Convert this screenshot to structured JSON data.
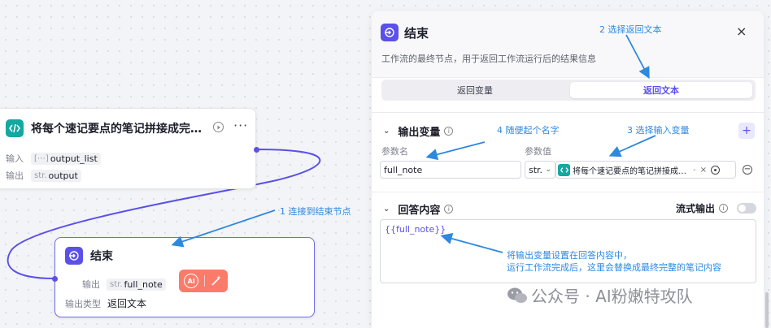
{
  "canvas": {
    "joiner_node": {
      "title": "将每个速记要点的笔记拼接成完…",
      "inputs_label": "输入",
      "inputs_prefix": "[⋯]",
      "inputs_value": "output_list",
      "outputs_label": "输出",
      "outputs_prefix": "str.",
      "outputs_value": "output"
    },
    "end_node": {
      "title": "结束",
      "output_label": "输出",
      "output_prefix": "str.",
      "output_value": "full_note",
      "output_type_label": "输出类型",
      "output_type_value": "返回文本",
      "ai_badge": "AI"
    }
  },
  "panel": {
    "title": "结束",
    "description": "工作流的最终节点，用于返回工作流运行后的结果信息",
    "close": "×",
    "tabs": [
      {
        "label": "返回变量",
        "selected": false
      },
      {
        "label": "返回文本",
        "selected": true
      }
    ],
    "output_section": {
      "title": "输出变量",
      "param_name_label": "参数名",
      "param_value_label": "参数值",
      "param_name": "full_note",
      "type_select": "str.",
      "value_ref": "将每个速记要点的笔记拼接成…",
      "value_more": "-",
      "value_clear": "×",
      "add_button": "+",
      "remove_button": "−"
    },
    "answer_section": {
      "title": "回答内容",
      "stream_label": "流式输出",
      "content": "{{full_note}}"
    }
  },
  "annotations": {
    "a1": "1 连接到结束节点",
    "a2": "2 选择返回文本",
    "a3": "3 选择输入变量",
    "a4": "4 随便起个名字",
    "a5_line1": "将输出变量设置在回答内容中，",
    "a5_line2": "运行工作流完成后，这里会替换成最终完整的笔记内容"
  },
  "watermark": {
    "text": "公众号 · AI粉嫩特攻队"
  },
  "colors": {
    "accent": "#5b50e8",
    "annotation": "#2d88e0",
    "ai_badge": "#fa7b6a",
    "teal_icon": "#13a8a0"
  }
}
